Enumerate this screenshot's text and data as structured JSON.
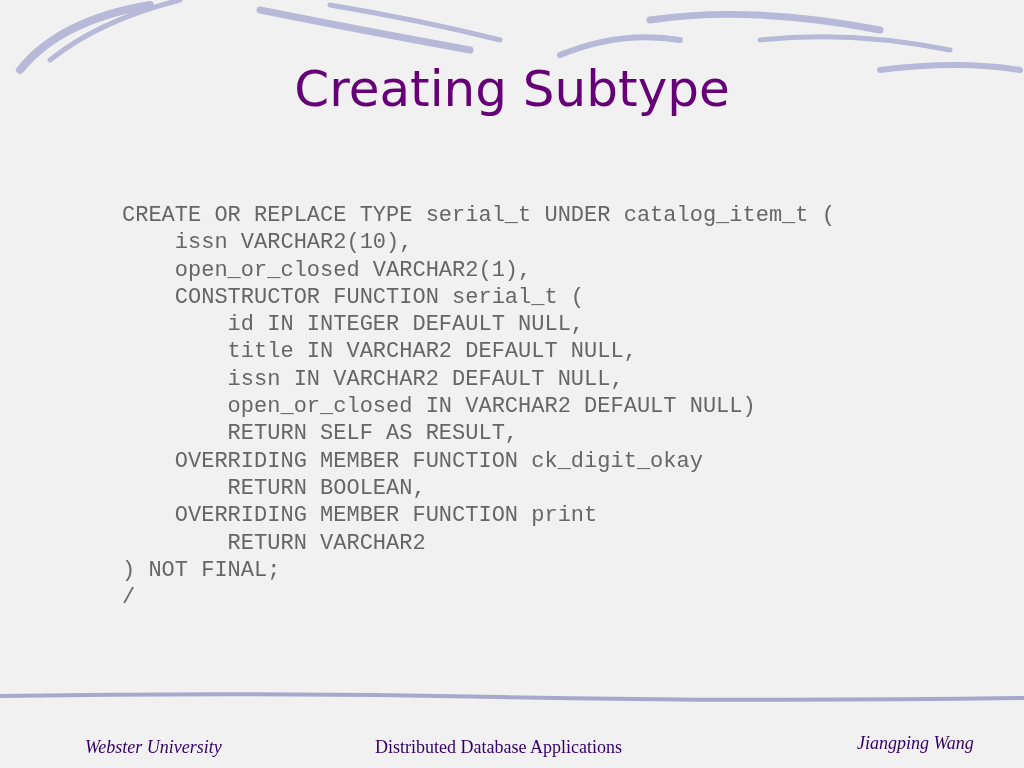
{
  "slide": {
    "title": "Creating Subtype",
    "code_lines": [
      "CREATE OR REPLACE TYPE serial_t UNDER catalog_item_t (",
      "    issn VARCHAR2(10),",
      "    open_or_closed VARCHAR2(1),",
      "    CONSTRUCTOR FUNCTION serial_t (",
      "        id IN INTEGER DEFAULT NULL,",
      "        title IN VARCHAR2 DEFAULT NULL,",
      "        issn IN VARCHAR2 DEFAULT NULL,",
      "        open_or_closed IN VARCHAR2 DEFAULT NULL)",
      "        RETURN SELF AS RESULT,",
      "    OVERRIDING MEMBER FUNCTION ck_digit_okay",
      "        RETURN BOOLEAN,",
      "    OVERRIDING MEMBER FUNCTION print",
      "        RETURN VARCHAR2",
      ") NOT FINAL;",
      "/"
    ]
  },
  "footer": {
    "left": "Webster University",
    "center": "Distributed Database Applications",
    "right": "Jiangping Wang"
  }
}
